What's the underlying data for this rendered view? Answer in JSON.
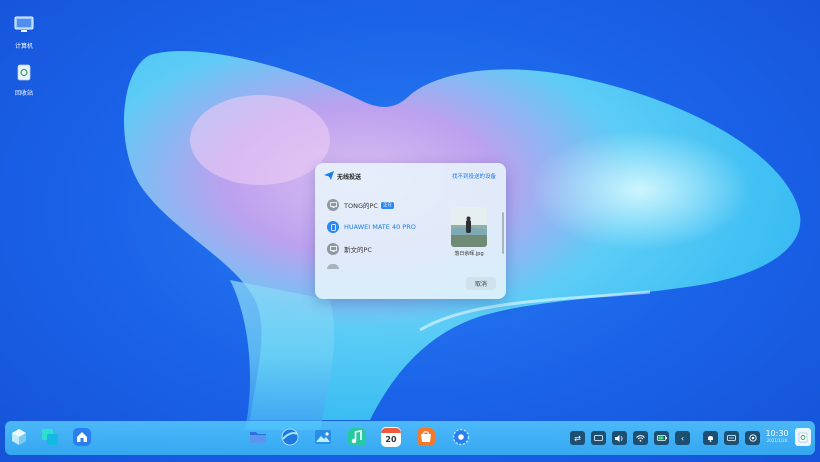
{
  "desktop": {
    "icons": [
      {
        "label": "计算机",
        "icon": "computer-icon"
      },
      {
        "label": "回收站",
        "icon": "trash-icon"
      }
    ]
  },
  "share_dialog": {
    "title": "无线投送",
    "help_link": "找不到投送的设备",
    "devices": [
      {
        "name": "TONG的PC",
        "badge": "正在",
        "icon": "monitor-icon",
        "highlighted": false
      },
      {
        "name": "HUAWEI MATE 40 PRO",
        "icon": "phone-icon",
        "highlighted": true
      },
      {
        "name": "斯文的PC",
        "icon": "monitor-icon",
        "highlighted": false
      }
    ],
    "file_name": "落日余晖.jpg",
    "cancel_label": "取消"
  },
  "taskbar": {
    "left_apps": [
      "launcher-icon",
      "multitask-icon",
      "home-icon"
    ],
    "center_apps": [
      "file-manager-icon",
      "browser-icon",
      "gallery-icon",
      "music-icon",
      "calendar-icon",
      "app-store-icon",
      "settings-icon"
    ],
    "calendar_day": "20",
    "tray": [
      "share-icon",
      "keyboard-icon",
      "volume-icon",
      "wifi-icon",
      "battery-icon",
      "collapse-icon",
      "notification-icon",
      "input-method-icon",
      "power-icon"
    ],
    "clock_time": "10:30",
    "clock_date": "2021/1/20",
    "accent": "#2a86f0"
  }
}
